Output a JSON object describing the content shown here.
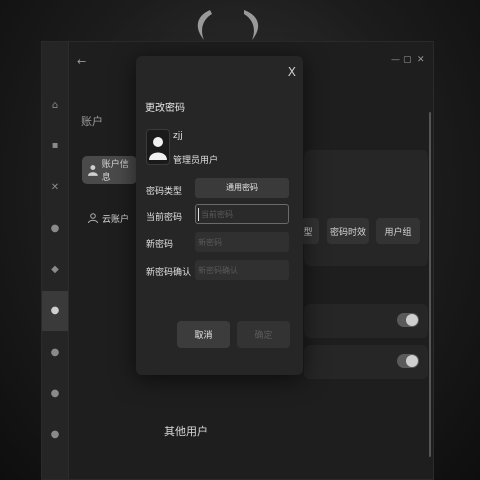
{
  "background_window": {
    "section_title": "账户",
    "menu": [
      {
        "label": "账户信息",
        "icon": "user-icon",
        "active": true
      },
      {
        "label": "云账户",
        "icon": "cloud-user-icon",
        "active": false
      }
    ],
    "chips": [
      "型",
      "密码时效",
      "用户组"
    ],
    "other_users_label": "其他用户"
  },
  "dialog": {
    "title": "更改密码",
    "close_glyph": "X",
    "user": {
      "name": "zjj",
      "role": "管理员用户"
    },
    "fields": {
      "password_type": {
        "label": "密码类型",
        "value": "通用密码"
      },
      "current_password": {
        "label": "当前密码",
        "placeholder": "当前密码"
      },
      "new_password": {
        "label": "新密码",
        "placeholder": "新密码"
      },
      "confirm_password": {
        "label": "新密码确认",
        "placeholder": "新密码确认"
      }
    },
    "buttons": {
      "cancel": "取消",
      "confirm": "确定"
    }
  },
  "colors": {
    "accent_active_menu": "#4a4a4a",
    "dialog_bg": "#262626"
  }
}
